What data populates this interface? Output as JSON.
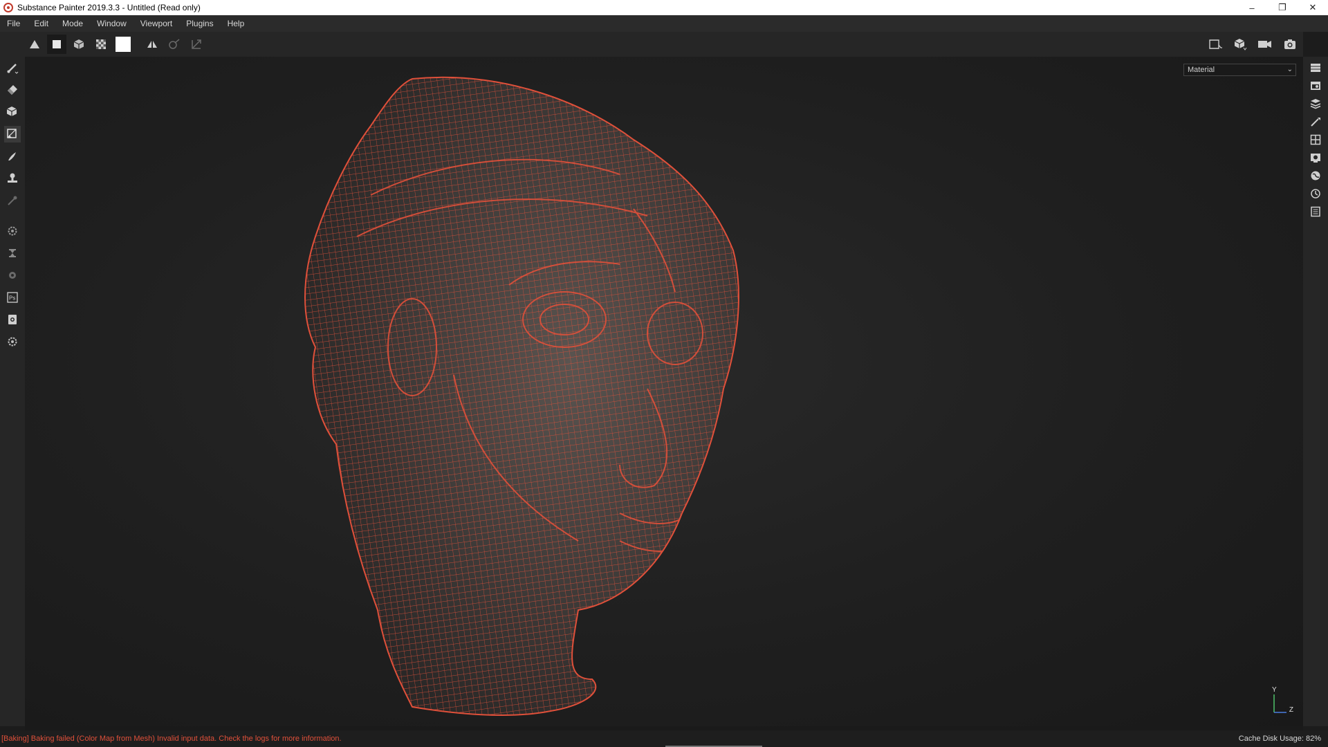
{
  "window": {
    "title": "Substance Painter 2019.3.3 - Untitled (Read only)",
    "controls": {
      "minimize": "–",
      "restore": "❐",
      "close": "✕"
    }
  },
  "menu": {
    "items": [
      "File",
      "Edit",
      "Mode",
      "Window",
      "Viewport",
      "Plugins",
      "Help"
    ]
  },
  "toolbar": {
    "left_icons": [
      "symmetry-icon",
      "solid-square-icon",
      "cube-icon",
      "checker-icon",
      "white-swatch-icon",
      "mirror-icon",
      "lazy-mouse-icon",
      "transform-icon"
    ],
    "right_icons": [
      "perspective-view-icon",
      "object-cube-icon",
      "camera-icon",
      "screenshot-icon"
    ]
  },
  "left_tools": [
    "paint-brush-icon",
    "eraser-icon",
    "projection-icon",
    "polygon-fill-icon",
    "smudge-icon",
    "clone-icon",
    "color-picker-icon",
    "bake-settings-icon",
    "iray-icon",
    "sculpt-icon",
    "photoshop-icon",
    "export-icon",
    "plugin-settings-icon"
  ],
  "right_tools": [
    "texture-set-list-icon",
    "texture-set-settings-icon",
    "layers-icon",
    "properties-icon",
    "display-settings-icon",
    "viewer-settings-icon",
    "environment-icon",
    "history-icon",
    "log-icon"
  ],
  "viewport": {
    "channel_select": "Material",
    "axis_y": "Y",
    "axis_z": "Z",
    "wire_color": "#e0503a"
  },
  "status": {
    "error_message": "[Baking] Baking failed (Color Map from Mesh) Invalid input data. Check the logs for more information.",
    "cache_usage": "Cache Disk Usage:    82%"
  },
  "colors": {
    "accent_error": "#e0503a",
    "panel_bg": "#262626",
    "viewport_bg": "#1f1f1f"
  }
}
